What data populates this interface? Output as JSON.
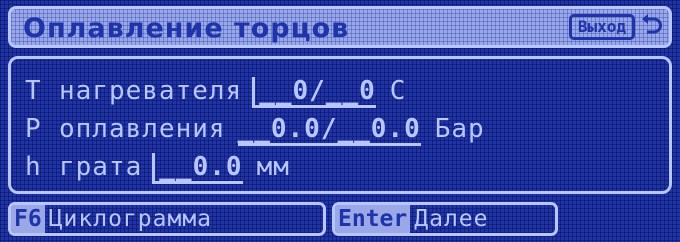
{
  "header": {
    "title": "Оплавление торцов",
    "exit_label": "Выход",
    "return_icon": "return-arrow-icon"
  },
  "params": [
    {
      "symbol": "T",
      "label": "нагревателя",
      "value": "__0/__0",
      "unit": "C"
    },
    {
      "symbol": "P",
      "label": "оплавления",
      "value": "__0.0/__0.0",
      "unit": "Бар"
    },
    {
      "symbol": "h",
      "label": "грата",
      "value": "__0.0",
      "unit": "мм"
    }
  ],
  "softkeys": {
    "f6": {
      "key": "F6",
      "label": "Циклограмма"
    },
    "enter": {
      "key": "Enter",
      "label": "Далее"
    }
  },
  "colors": {
    "background": "#1f34a8",
    "foreground": "#b8c6ff",
    "highlight": "#9aa8e8"
  }
}
